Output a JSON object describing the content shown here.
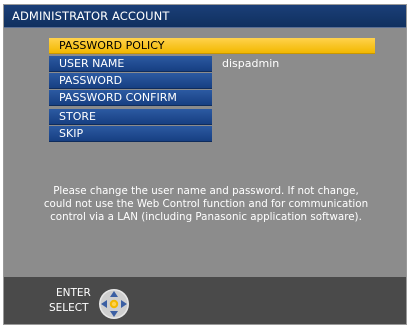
{
  "window": {
    "title": "ADMINISTRATOR ACCOUNT"
  },
  "menu": {
    "items": [
      {
        "label": "PASSWORD POLICY",
        "selected": true
      },
      {
        "label": "USER NAME",
        "value": "dispadmin"
      },
      {
        "label": "PASSWORD"
      },
      {
        "label": "PASSWORD CONFIRM"
      },
      {
        "label": "STORE"
      },
      {
        "label": "SKIP"
      }
    ]
  },
  "message": {
    "line1": "Please change the user name and password. If not change,",
    "line2": "could not use the Web Control function and for communication",
    "line3": "control via a LAN (including Panasonic application software)."
  },
  "footer": {
    "enter_label": "ENTER",
    "select_label": "SELECT",
    "icon": "dpad-icon"
  },
  "colors": {
    "title_bar": "#1b3f78",
    "selected_item": "#f2b800",
    "menu_item": "#2c5aa2",
    "background": "#8c8c8c",
    "bottom_bar": "#4a4a4a"
  }
}
